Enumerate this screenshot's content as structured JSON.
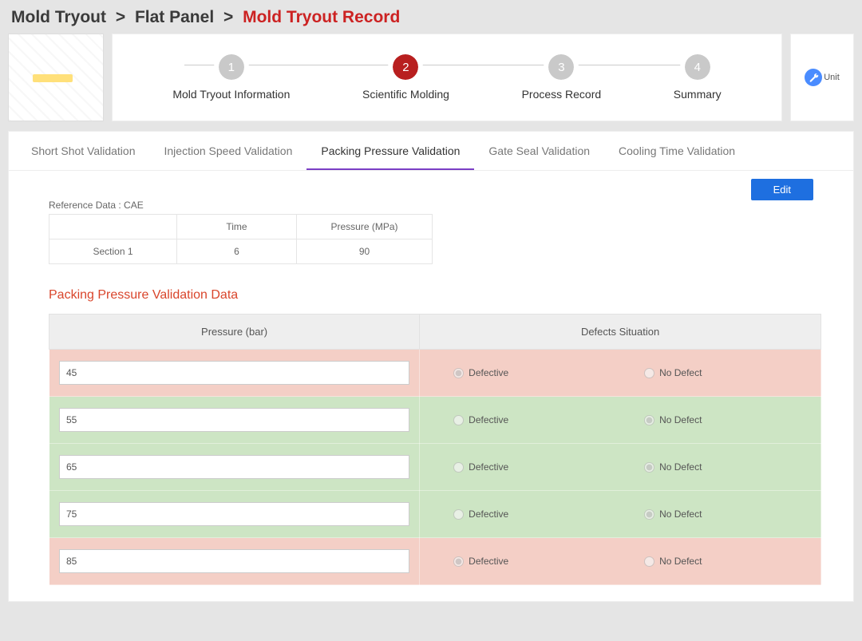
{
  "breadcrumb": {
    "part1": "Mold Tryout",
    "part2": "Flat Panel",
    "part3": "Mold Tryout Record",
    "sep": ">"
  },
  "steps": [
    {
      "num": "1",
      "label": "Mold Tryout Information",
      "active": false
    },
    {
      "num": "2",
      "label": "Scientific Molding",
      "active": true
    },
    {
      "num": "3",
      "label": "Process Record",
      "active": false
    },
    {
      "num": "4",
      "label": "Summary",
      "active": false
    }
  ],
  "unit": {
    "label": "Unit"
  },
  "subtabs": [
    {
      "label": "Short Shot Validation",
      "active": false
    },
    {
      "label": "Injection Speed Validation",
      "active": false
    },
    {
      "label": "Packing Pressure Validation",
      "active": true
    },
    {
      "label": "Gate Seal Validation",
      "active": false
    },
    {
      "label": "Cooling Time Validation",
      "active": false
    }
  ],
  "edit_label": "Edit",
  "reference": {
    "label": "Reference Data : CAE",
    "headers": {
      "blank": "",
      "time": "Time",
      "pressure": "Pressure (MPa)"
    },
    "row": {
      "name": "Section 1",
      "time": "6",
      "pressure": "90"
    }
  },
  "section_title": "Packing Pressure Validation Data",
  "data_headers": {
    "pressure": "Pressure (bar)",
    "defects": "Defects Situation"
  },
  "defect_labels": {
    "defective": "Defective",
    "nodefect": "No Defect"
  },
  "rows": [
    {
      "value": "45",
      "status": "defective",
      "color": "red"
    },
    {
      "value": "55",
      "status": "nodefect",
      "color": "green"
    },
    {
      "value": "65",
      "status": "nodefect",
      "color": "green"
    },
    {
      "value": "75",
      "status": "nodefect",
      "color": "green"
    },
    {
      "value": "85",
      "status": "defective",
      "color": "red"
    }
  ]
}
